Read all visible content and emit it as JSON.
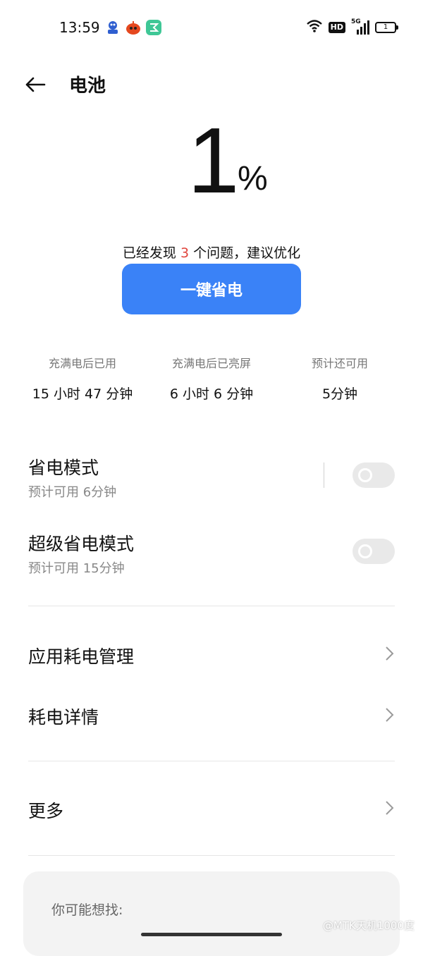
{
  "status_bar": {
    "time": "13:59",
    "network": "5G",
    "hd": "HD",
    "battery_level": "1"
  },
  "header": {
    "title": "电池"
  },
  "battery": {
    "percent": "1",
    "percent_sign": "%"
  },
  "issues": {
    "prefix": "已经发现 ",
    "count": "3",
    "suffix": " 个问题，建议优化"
  },
  "optimize_button": "一键省电",
  "stats": [
    {
      "label": "充满电后已用",
      "value": "15 小时 47 分钟"
    },
    {
      "label": "充满电后已亮屏",
      "value": "6 小时 6 分钟"
    },
    {
      "label": "预计还可用",
      "value": "5分钟"
    }
  ],
  "modes": [
    {
      "title": "省电模式",
      "subtitle": "预计可用 6分钟",
      "enabled": false
    },
    {
      "title": "超级省电模式",
      "subtitle": "预计可用 15分钟",
      "enabled": false
    }
  ],
  "menu": [
    {
      "label": "应用耗电管理"
    },
    {
      "label": "耗电详情"
    },
    {
      "label": "更多"
    }
  ],
  "suggestions": {
    "title": "你可能想找:"
  },
  "watermark": "@MTK天机1000度",
  "colors": {
    "accent": "#3a82f7",
    "alert": "#e0443c"
  }
}
